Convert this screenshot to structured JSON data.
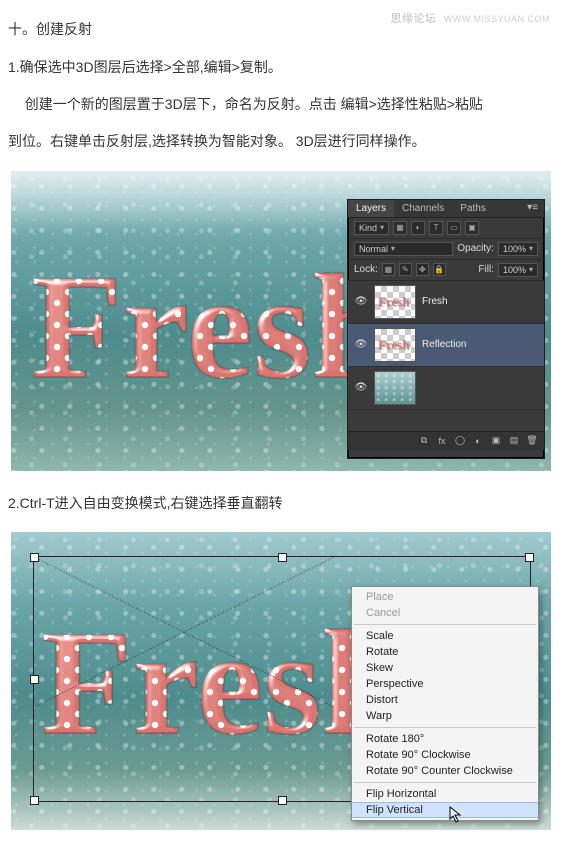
{
  "watermark": {
    "site": "思缘论坛",
    "url": "WWW.MISSYUAN.COM"
  },
  "section_title": "十。创建反射",
  "step1_line1": "1.确保选中3D图层后选择>全部,编辑>复制。",
  "step1_line2": "创建一个新的图层置于3D层下，命名为反射。点击 编辑>选择性粘贴>粘贴",
  "step1_line3": "到位。右键单击反射层,选择转换为智能对象。 3D层进行同样操作。",
  "step2": "2.Ctrl-T进入自由变换模式,右键选择垂直翻转",
  "fresh_text": "Fresh",
  "layers_panel": {
    "tabs": [
      "Layers",
      "Channels",
      "Paths"
    ],
    "kind_label": "Kind",
    "blend_mode": "Normal",
    "opacity_label": "Opacity:",
    "opacity_value": "100%",
    "lock_label": "Lock:",
    "fill_label": "Fill:",
    "fill_value": "100%",
    "layers": [
      {
        "name": "Fresh"
      },
      {
        "name": "Reflection"
      },
      {
        "name": ""
      }
    ]
  },
  "context_menu": {
    "items": [
      {
        "label": "Place",
        "disabled": true
      },
      {
        "label": "Cancel",
        "disabled": true
      },
      {
        "sep": true
      },
      {
        "label": "Scale"
      },
      {
        "label": "Rotate"
      },
      {
        "label": "Skew"
      },
      {
        "label": "Perspective"
      },
      {
        "label": "Distort"
      },
      {
        "label": "Warp"
      },
      {
        "sep": true
      },
      {
        "label": "Rotate 180°"
      },
      {
        "label": "Rotate 90° Clockwise"
      },
      {
        "label": "Rotate 90° Counter Clockwise"
      },
      {
        "sep": true
      },
      {
        "label": "Flip Horizontal"
      },
      {
        "label": "Flip Vertical",
        "hover": true
      }
    ]
  }
}
